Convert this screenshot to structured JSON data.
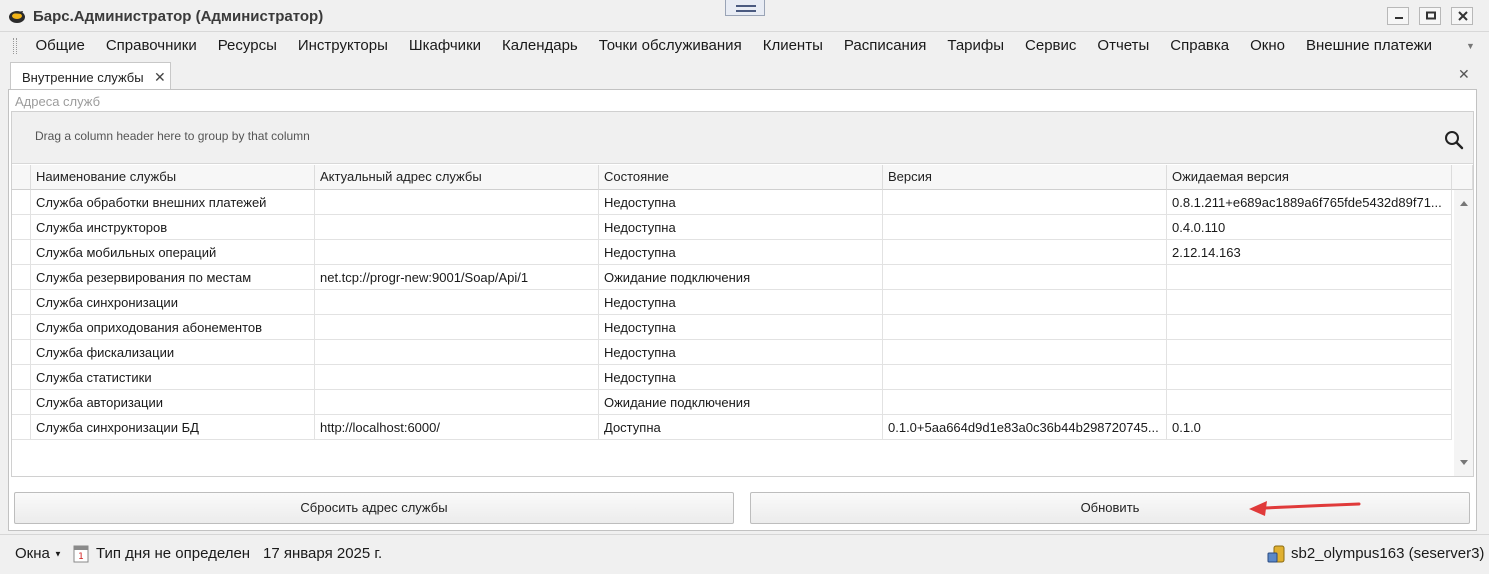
{
  "window": {
    "title": "Барс.Администратор (Администратор)"
  },
  "menu": {
    "items": [
      "Общие",
      "Справочники",
      "Ресурсы",
      "Инструкторы",
      "Шкафчики",
      "Календарь",
      "Точки обслуживания",
      "Клиенты",
      "Расписания",
      "Тарифы",
      "Сервис",
      "Отчеты",
      "Справка",
      "Окно",
      "Внешние платежи"
    ]
  },
  "tabs": {
    "active_label": "Внутренние службы"
  },
  "section": {
    "title": "Адреса служб"
  },
  "grid": {
    "group_hint": "Drag a column header here to group by that column",
    "columns": [
      "Наименование службы",
      "Актуальный адрес службы",
      "Состояние",
      "Версия",
      "Ожидаемая версия"
    ],
    "rows": [
      [
        "Служба обработки внешних платежей",
        "",
        "Недоступна",
        "",
        "0.8.1.211+e689ac1889a6f765fde5432d89f71..."
      ],
      [
        "Служба инструкторов",
        "",
        "Недоступна",
        "",
        "0.4.0.110"
      ],
      [
        "Служба мобильных операций",
        "",
        "Недоступна",
        "",
        "2.12.14.163"
      ],
      [
        "Служба резервирования по местам",
        "net.tcp://progr-new:9001/Soap/Api/1",
        "Ожидание подключения",
        "",
        ""
      ],
      [
        "Служба синхронизации",
        "",
        "Недоступна",
        "",
        ""
      ],
      [
        "Служба оприходования абонементов",
        "",
        "Недоступна",
        "",
        ""
      ],
      [
        "Служба фискализации",
        "",
        "Недоступна",
        "",
        ""
      ],
      [
        "Служба статистики",
        "",
        "Недоступна",
        "",
        ""
      ],
      [
        "Служба авторизации",
        "",
        "Ожидание подключения",
        "",
        ""
      ],
      [
        "Служба синхронизации БД",
        "http://localhost:6000/",
        "Доступна",
        "0.1.0+5aa664d9d1e83a0c36b44b298720745...",
        "0.1.0"
      ]
    ]
  },
  "buttons": {
    "reset": "Сбросить адрес службы",
    "refresh": "Обновить"
  },
  "status": {
    "windows_menu": "Окна",
    "day_type": "Тип дня не определен",
    "date": "17 января 2025 г.",
    "connection": "sb2_olympus163 (seserver3)"
  },
  "colors": {
    "annotation_arrow": "#e03a3a"
  }
}
